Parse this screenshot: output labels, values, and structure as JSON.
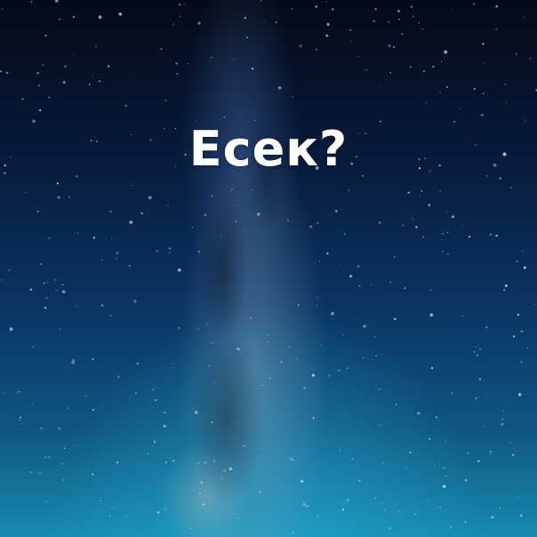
{
  "caption": {
    "text": "Есек?",
    "color": "#ffffff"
  },
  "scene": {
    "subject": "milky-way-night-sky",
    "palette": {
      "sky_top": "#050a18",
      "sky_mid": "#0a3260",
      "sky_bottom": "#168bb0"
    }
  }
}
